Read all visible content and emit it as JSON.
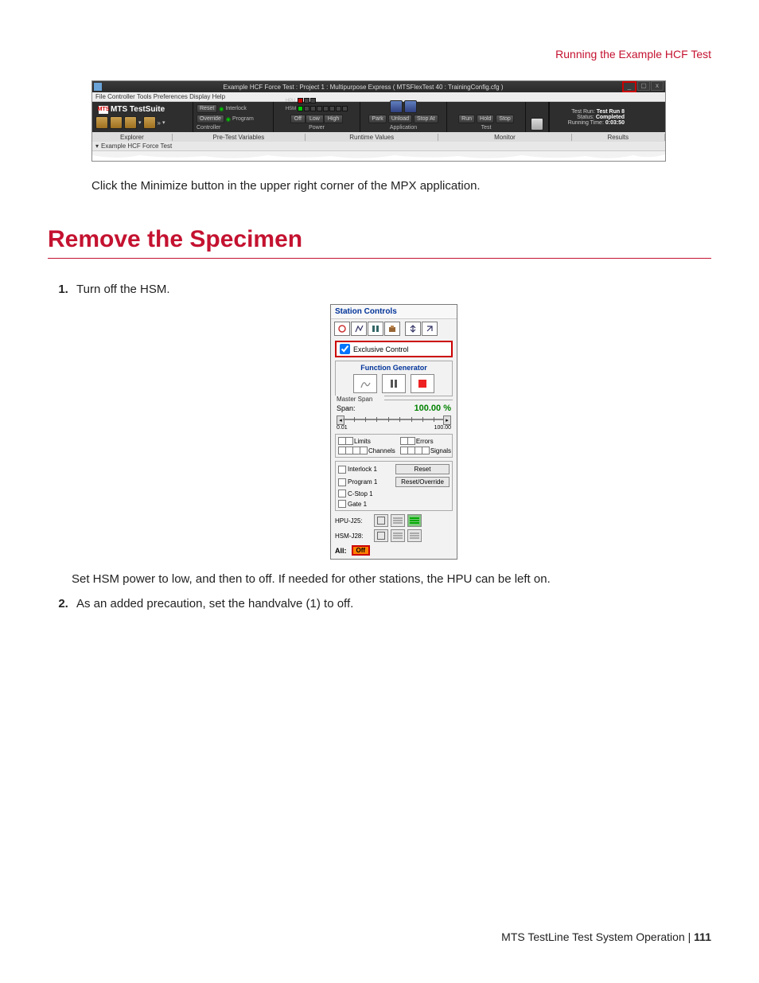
{
  "header": {
    "running_title": "Running the Example HCF Test"
  },
  "mpx": {
    "title": "Example HCF Force Test : Project 1 : Multipurpose Express ( MTSFlexTest 40 : TrainingConfig.cfg )",
    "menu": "File  Controller  Tools  Preferences  Display  Help",
    "logo_brand": "MTS",
    "logo_prod": "TestSuite",
    "reset": "Reset",
    "override": "Override",
    "interlock": "Interlock",
    "program": "Program",
    "controller": "Controller",
    "hpu": "HPU",
    "hsm": "HSM",
    "off": "Off",
    "low": "Low",
    "high": "High",
    "power": "Power",
    "park": "Park",
    "unload": "Unload",
    "stopat": "Stop At",
    "application": "Application",
    "run": "Run",
    "hold": "Hold",
    "stop": "Stop",
    "test": "Test",
    "test_run_label": "Test Run:",
    "test_run_value": "Test Run 8",
    "status_label": "Status:",
    "status_value": "Completed",
    "runtime_label": "Running Time:",
    "runtime_value": "0:03:50",
    "tabs": {
      "explorer": "Explorer",
      "pretest": "Pre-Test Variables",
      "runtime": "Runtime Values",
      "monitor": "Monitor",
      "results": "Results"
    },
    "tree_item": "Example HCF Force Test"
  },
  "intro_para": "Click the Minimize button in the upper right corner of the MPX application.",
  "section_title": "Remove the Specimen",
  "step1": "Turn off the HSM.",
  "station": {
    "title": "Station Controls",
    "exclusive": "Exclusive Control",
    "fg_title": "Function Generator",
    "master_span": "Master Span",
    "span_label": "Span:",
    "span_value": "100.00 %",
    "range_lo": "0.01",
    "range_hi": "100.00",
    "limits": "Limits",
    "errors": "Errors",
    "channels": "Channels",
    "signals": "Signals",
    "interlock1": "Interlock 1",
    "reset": "Reset",
    "program1": "Program 1",
    "reset_over": "Reset/Override",
    "cstop1": "C-Stop 1",
    "gate1": "Gate 1",
    "hpu": "HPU-J25:",
    "hsm": "HSM-J28:",
    "all": "All:",
    "off": "Off"
  },
  "para_after_station": "Set HSM power to low, and then to off. If needed for other stations, the HPU can be left on.",
  "step2": "As an added precaution, set the handvalve (1) to off.",
  "footer": {
    "doc": "MTS TestLine Test System Operation",
    "sep": " | ",
    "page": "111"
  }
}
